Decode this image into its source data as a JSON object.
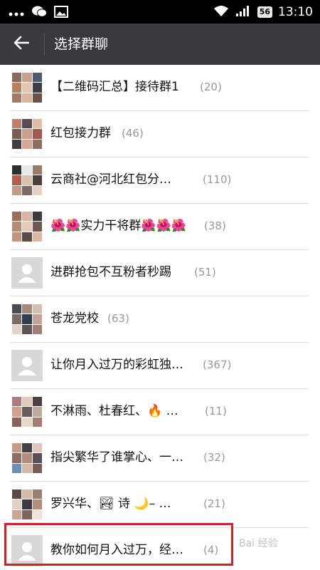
{
  "status_bar": {
    "time": "13:10",
    "battery": "56"
  },
  "header": {
    "title": "选择群聊"
  },
  "groups": [
    {
      "name": "【二维码汇总】接待群1",
      "count": "(20)",
      "avatar": "grid"
    },
    {
      "name": "红包接力群",
      "count": "(46)",
      "avatar": "grid"
    },
    {
      "name": "云商社@河北红包分…",
      "count": "(110)",
      "avatar": "grid"
    },
    {
      "name": "🌺🌺实力干将群🌺🌺🌺",
      "count": "(38)",
      "avatar": "grid"
    },
    {
      "name": "进群抢包不互粉者秒踢",
      "count": "(51)",
      "avatar": "default"
    },
    {
      "name": "苍龙党校",
      "count": "(63)",
      "avatar": "grid"
    },
    {
      "name": "让你月入过万的彩虹独…",
      "count": "(367)",
      "avatar": "default"
    },
    {
      "name": "不淋雨、杜春红、🔥 …",
      "count": "(11)",
      "avatar": "grid"
    },
    {
      "name": "指尖繁华了谁掌心、一…",
      "count": "(32)",
      "avatar": "grid"
    },
    {
      "name": "罗兴华、🏞 诗 🌙– …",
      "count": "(21)",
      "avatar": "grid"
    },
    {
      "name": "教你如何月入过万，经…",
      "count": "(4)",
      "avatar": "default"
    }
  ],
  "watermark": "Bai 经验",
  "colors": {
    "header_bg": "#393a3f",
    "highlight": "#d0202a"
  }
}
